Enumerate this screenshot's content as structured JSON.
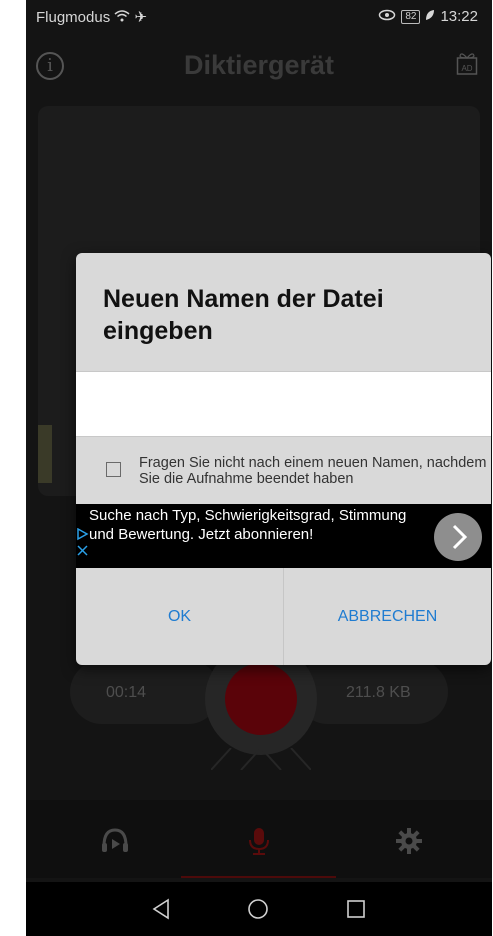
{
  "status_bar": {
    "left_text": "Flugmodus",
    "battery": "82",
    "time": "13:22"
  },
  "app_bar": {
    "title": "Diktiergerät",
    "info_icon": "info-icon",
    "ad_icon": "ad-gift-icon",
    "ad_label": "AD"
  },
  "recorder": {
    "elapsed": "00:14",
    "file_size": "211.8 KB",
    "record_color": "#5a0309"
  },
  "dialog": {
    "title": "Neuen Namen der Datei eingeben",
    "input_value": "",
    "checkbox_label": "Fragen Sie nicht nach einem neuen Namen, nachdem Sie die Aufnahme beendet haben",
    "checkbox_checked": false,
    "ad": {
      "text": "Suche nach Typ, Schwierigkeitsgrad, Stimmung und Bewertung. Jetzt abonnieren!"
    },
    "ok_label": "OK",
    "cancel_label": "ABBRECHEN",
    "button_color": "#1f7cd1"
  },
  "bottom_nav": {
    "items": [
      "play-headphones-icon",
      "microphone-icon",
      "gear-icon"
    ],
    "active": "microphone-icon"
  },
  "system_nav": [
    "back-icon",
    "home-icon",
    "recents-icon"
  ]
}
